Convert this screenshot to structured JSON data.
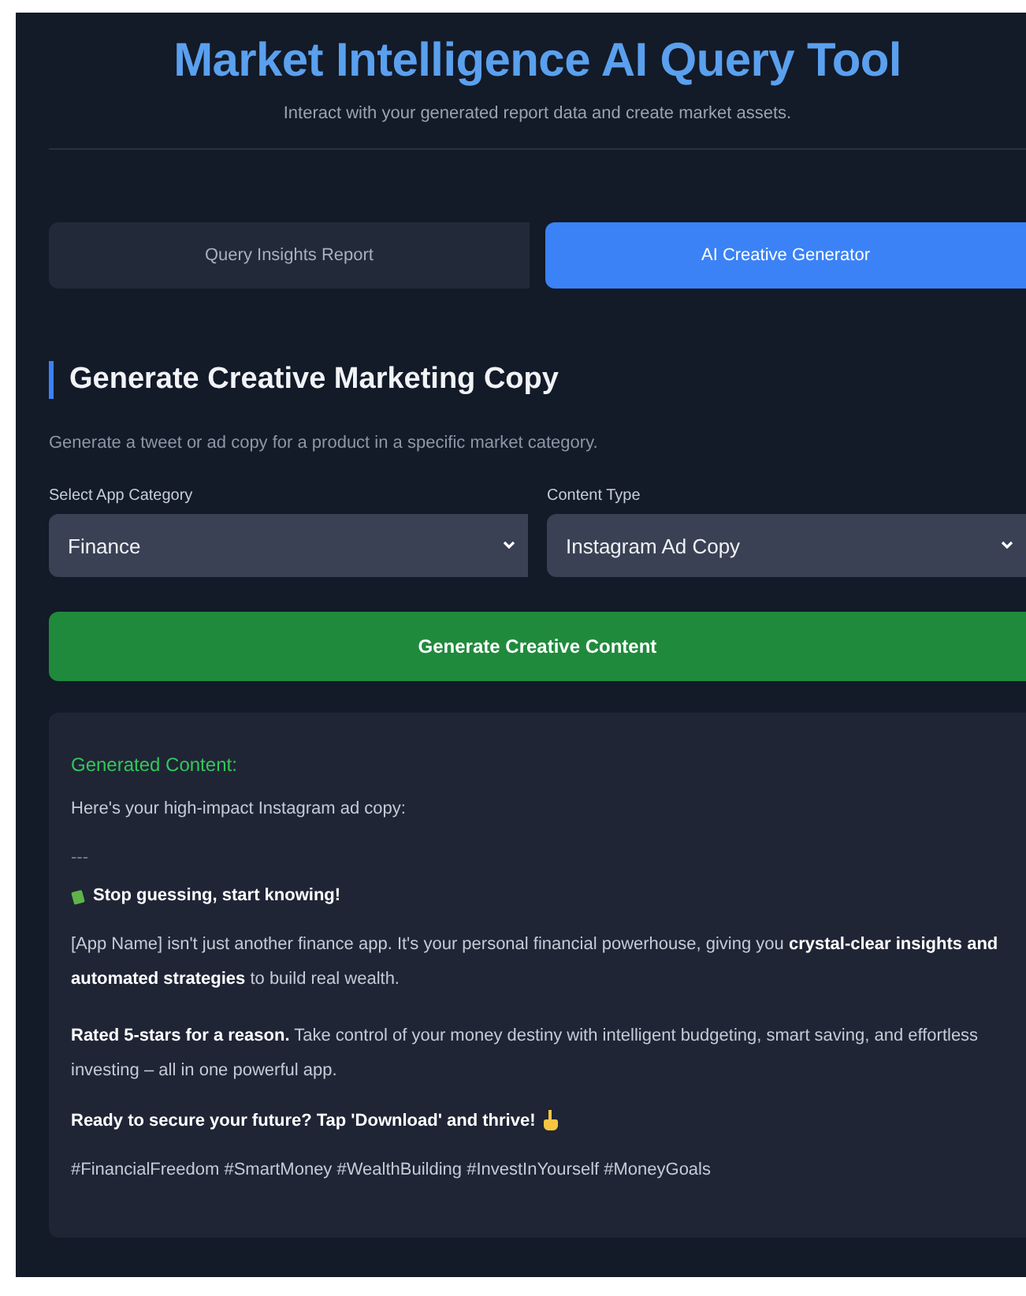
{
  "header": {
    "title": "Market Intelligence AI Query Tool",
    "subtitle": "Interact with your generated report data and create market assets."
  },
  "tabs": [
    {
      "label": "Query Insights Report",
      "selected": false
    },
    {
      "label": "AI Creative Generator",
      "selected": true
    }
  ],
  "section": {
    "title": "Generate Creative Marketing Copy",
    "description": "Generate a tweet or ad copy for a product in a specific market category."
  },
  "fields": [
    {
      "label": "Select App Category",
      "value": "Finance"
    },
    {
      "label": "Content Type",
      "value": "Instagram Ad Copy"
    }
  ],
  "generate_button": "Generate Creative Content",
  "result": {
    "label": "Generated Content:",
    "blocks": [
      {
        "kind": "text",
        "text": "Here's your high-impact Instagram ad copy:"
      },
      {
        "kind": "rule",
        "text": "---"
      },
      {
        "kind": "lead_headline",
        "text": "Stop guessing, start knowing!"
      },
      {
        "kind": "text",
        "text": "[App Name] isn't just another finance app. It's your personal financial powerhouse, giving you **crystal-clear insights and automated strategies** to build real wealth."
      },
      {
        "kind": "text",
        "text": "**Rated 5-stars for a reason.** Take control of your money destiny with intelligent budgeting, smart saving, and effortless investing – all in one powerful app."
      },
      {
        "kind": "trail_headline",
        "text": "Ready to secure your future? Tap 'Download' and thrive!"
      },
      {
        "kind": "text",
        "text": "#FinancialFreedom #SmartMoney #WealthBuilding #InvestInYourself #MoneyGoals"
      }
    ]
  }
}
